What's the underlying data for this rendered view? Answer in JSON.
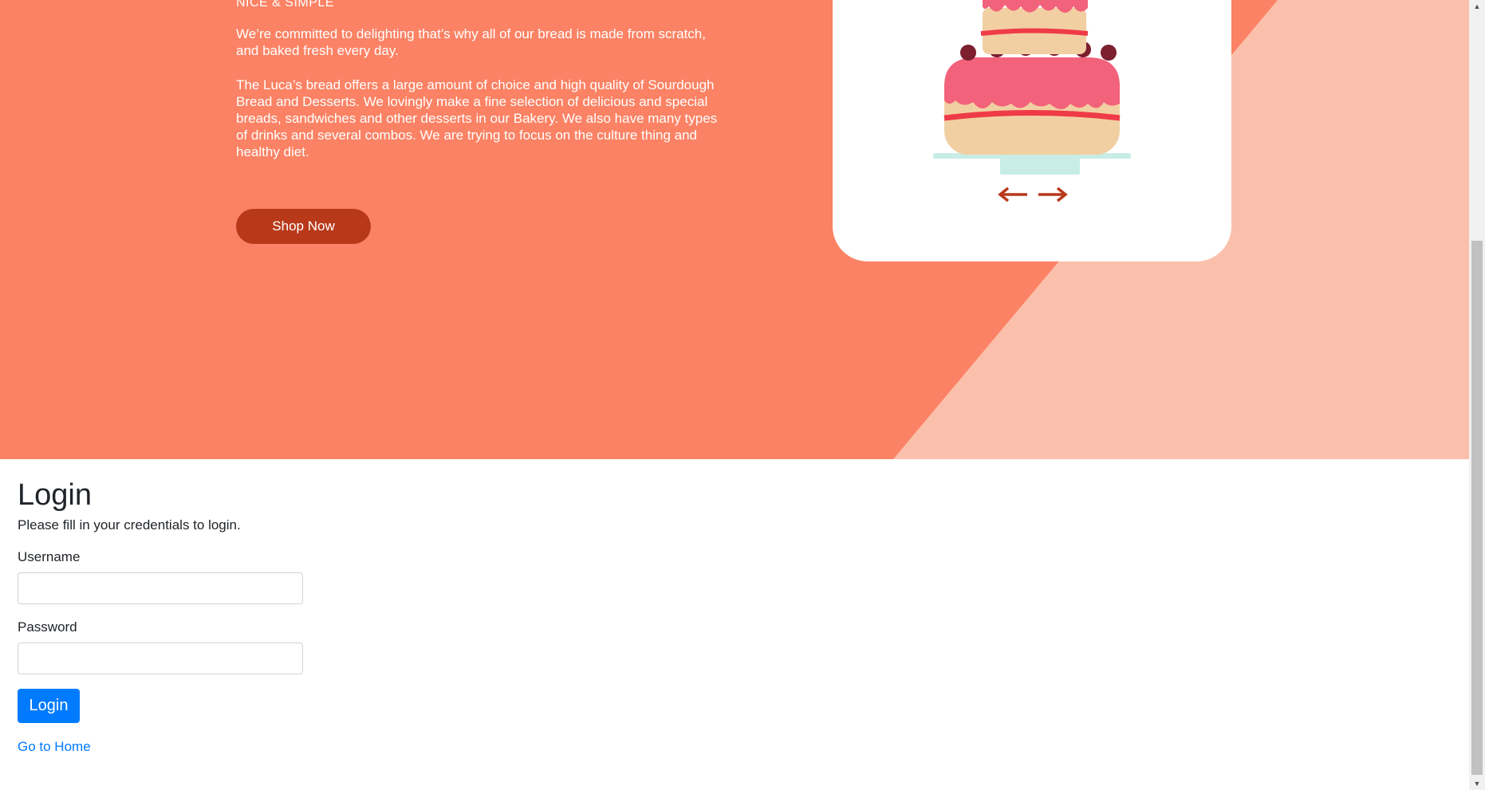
{
  "hero": {
    "tagline": "NICE & SIMPLE",
    "paragraph1": "We’re committed to delighting that’s why all of our bread is made from scratch, and baked fresh every day.",
    "paragraph2": "The Luca’s bread offers a large amount of choice and high quality of Sourdough Bread and Desserts. We lovingly make a fine selection of delicious and special breads, sandwiches and other desserts in our Bakery. We also have many types of drinks and several combos. We are trying to focus on the culture thing and healthy diet.",
    "shop_button": "Shop Now",
    "carousel": {
      "image_icon": "cake-icon",
      "prev_icon": "arrow-left-icon",
      "next_icon": "arrow-right-icon"
    },
    "colors": {
      "background": "#fb8264",
      "accent_light": "#fbc0ab",
      "button": "#b8391a"
    }
  },
  "login": {
    "title": "Login",
    "subtitle": "Please fill in your credentials to login.",
    "username_label": "Username",
    "username_value": "",
    "password_label": "Password",
    "password_value": "",
    "submit_label": "Login",
    "home_link": "Go to Home",
    "colors": {
      "primary": "#007bff"
    }
  }
}
